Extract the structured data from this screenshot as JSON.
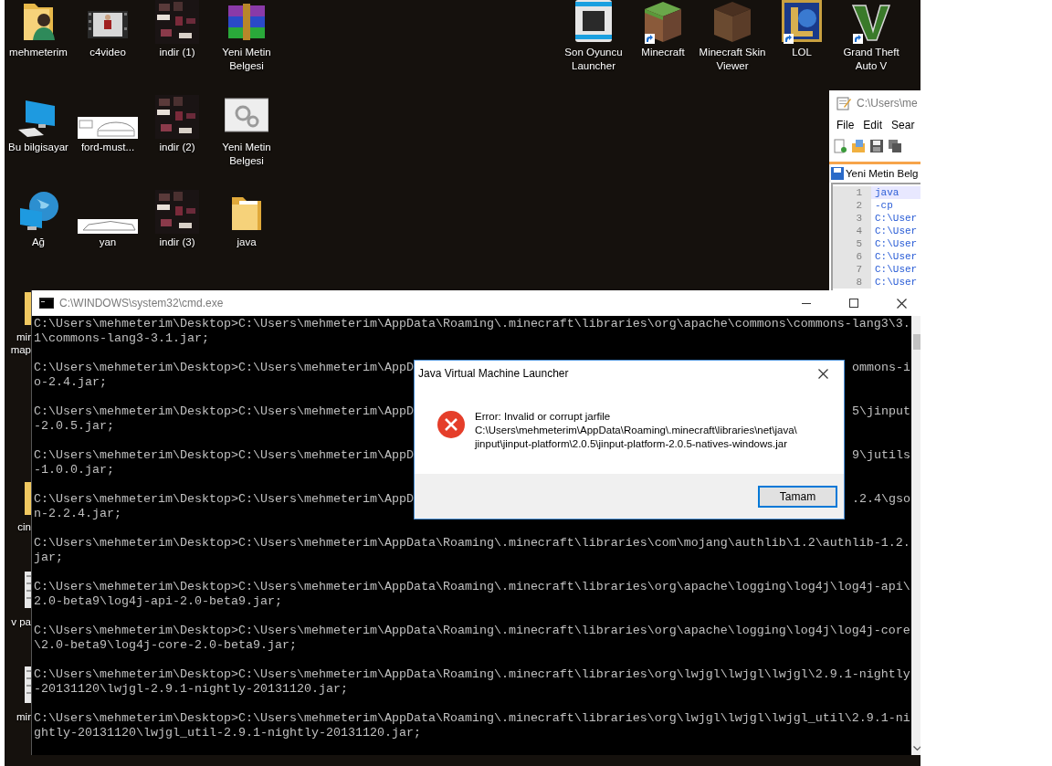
{
  "desktop": {
    "icon_columns": [
      [
        {
          "kind": "user-folder",
          "label": "mehmeterim",
          "shortcut": false
        },
        {
          "kind": "computer",
          "label": "Bu bilgisayar",
          "shortcut": false
        },
        {
          "kind": "network",
          "label": "Ağ",
          "shortcut": false
        }
      ],
      [
        {
          "kind": "video",
          "label": "c4video",
          "shortcut": false
        },
        {
          "kind": "car-sketch",
          "label": "ford-must...",
          "shortcut": false
        },
        {
          "kind": "car-side",
          "label": "yan",
          "shortcut": false
        }
      ],
      [
        {
          "kind": "skin-image",
          "label": "indir (1)",
          "shortcut": false
        },
        {
          "kind": "skin-image",
          "label": "indir (2)",
          "shortcut": false
        },
        {
          "kind": "skin-image",
          "label": "indir (3)",
          "shortcut": false
        }
      ],
      [
        {
          "kind": "archive",
          "label": "Yeni Metin Belgesi",
          "shortcut": false
        },
        {
          "kind": "settings-window",
          "label": "Yeni Metin Belgesi",
          "shortcut": false
        },
        {
          "kind": "folder",
          "label": "java",
          "shortcut": false
        }
      ]
    ],
    "top_right_icons": [
      {
        "kind": "launcher",
        "label": "Son Oyuncu Launcher",
        "shortcut": false
      },
      {
        "kind": "grass-block",
        "label": "Minecraft",
        "shortcut": true
      },
      {
        "kind": "cube",
        "label": "Minecraft Skin Viewer",
        "shortcut": false
      },
      {
        "kind": "emblem",
        "label": "LOL",
        "shortcut": true
      },
      {
        "kind": "chevron",
        "label": "Grand Theft Auto V",
        "shortcut": true
      }
    ],
    "covered_icons": [
      {
        "kind": "folder",
        "label": "mir map"
      },
      {
        "kind": "folder",
        "label": "cin"
      },
      {
        "kind": "document",
        "label": "v pa"
      },
      {
        "kind": "document",
        "label": "mir"
      }
    ]
  },
  "editor_window": {
    "title": "C:\\Users\\me",
    "menu": [
      "File",
      "Edit",
      "Sear"
    ],
    "tab": "Yeni Metin Belg",
    "lines": [
      {
        "number": "1",
        "code": "java",
        "selected": true
      },
      {
        "number": "2",
        "code": "-cp",
        "selected": false
      },
      {
        "number": "3",
        "code": "C:\\User",
        "selected": false
      },
      {
        "number": "4",
        "code": "C:\\User",
        "selected": false
      },
      {
        "number": "5",
        "code": "C:\\User",
        "selected": false
      },
      {
        "number": "6",
        "code": "C:\\User",
        "selected": false
      },
      {
        "number": "7",
        "code": "C:\\User",
        "selected": false
      },
      {
        "number": "8",
        "code": "C:\\User",
        "selected": false
      }
    ]
  },
  "console_window": {
    "title": "C:\\WINDOWS\\system32\\cmd.exe",
    "entries": [
      {
        "kind": "full",
        "line_1": "C:\\Users\\mehmeterim\\Desktop>C:\\Users\\mehmeterim\\AppData\\Roaming\\.minecraft\\libraries\\org\\apache\\commons\\commons-lang3\\3.",
        "line_2": "1\\commons-lang3-3.1.jar;"
      },
      {
        "kind": "covered",
        "line_1_start": "C:\\Users\\mehmeterim\\Desktop>C:\\Users\\mehmeterim\\AppD",
        "line_1_end": "ommons-i",
        "line_2": "o-2.4.jar;"
      },
      {
        "kind": "covered",
        "line_1_start": "C:\\Users\\mehmeterim\\Desktop>C:\\Users\\mehmeterim\\AppD",
        "line_1_end": "5\\jinput",
        "line_2": "-2.0.5.jar;"
      },
      {
        "kind": "covered",
        "line_1_start": "C:\\Users\\mehmeterim\\Desktop>C:\\Users\\mehmeterim\\AppD",
        "line_1_end": "9\\jutils",
        "line_2": "-1.0.0.jar;"
      },
      {
        "kind": "covered",
        "line_1_start": "C:\\Users\\mehmeterim\\Desktop>C:\\Users\\mehmeterim\\AppD",
        "line_1_end": ".2.4\\gso",
        "line_2": "n-2.2.4.jar;"
      },
      {
        "kind": "full",
        "line_1": "C:\\Users\\mehmeterim\\Desktop>C:\\Users\\mehmeterim\\AppData\\Roaming\\.minecraft\\libraries\\com\\mojang\\authlib\\1.2\\authlib-1.2.",
        "line_2": "jar;"
      },
      {
        "kind": "full",
        "line_1": "C:\\Users\\mehmeterim\\Desktop>C:\\Users\\mehmeterim\\AppData\\Roaming\\.minecraft\\libraries\\org\\apache\\logging\\log4j\\log4j-api\\",
        "line_2": "2.0-beta9\\log4j-api-2.0-beta9.jar;"
      },
      {
        "kind": "full",
        "line_1": "C:\\Users\\mehmeterim\\Desktop>C:\\Users\\mehmeterim\\AppData\\Roaming\\.minecraft\\libraries\\org\\apache\\logging\\log4j\\log4j-core",
        "line_2": "\\2.0-beta9\\log4j-core-2.0-beta9.jar;"
      },
      {
        "kind": "full",
        "line_1": "C:\\Users\\mehmeterim\\Desktop>C:\\Users\\mehmeterim\\AppData\\Roaming\\.minecraft\\libraries\\org\\lwjgl\\lwjgl\\lwjgl\\2.9.1-nightly",
        "line_2": "-20131120\\lwjgl-2.9.1-nightly-20131120.jar;"
      },
      {
        "kind": "full",
        "line_1": "C:\\Users\\mehmeterim\\Desktop>C:\\Users\\mehmeterim\\AppData\\Roaming\\.minecraft\\libraries\\org\\lwjgl\\lwjgl\\lwjgl_util\\2.9.1-ni",
        "line_2": "ghtly-20131120\\lwjgl_util-2.9.1-nightly-20131120.jar;"
      }
    ]
  },
  "error_dialog": {
    "title": "Java Virtual Machine Launcher",
    "message": "Error: Invalid or corrupt jarfile",
    "path_lines": [
      "C:\\Users\\mehmeterim\\AppData\\Roaming\\.minecraft\\libraries\\net\\java\\",
      "jinput\\jinput-platform\\2.0.5\\jinput-platform-2.0.5-natives-windows.jar"
    ],
    "button": "Tamam"
  }
}
